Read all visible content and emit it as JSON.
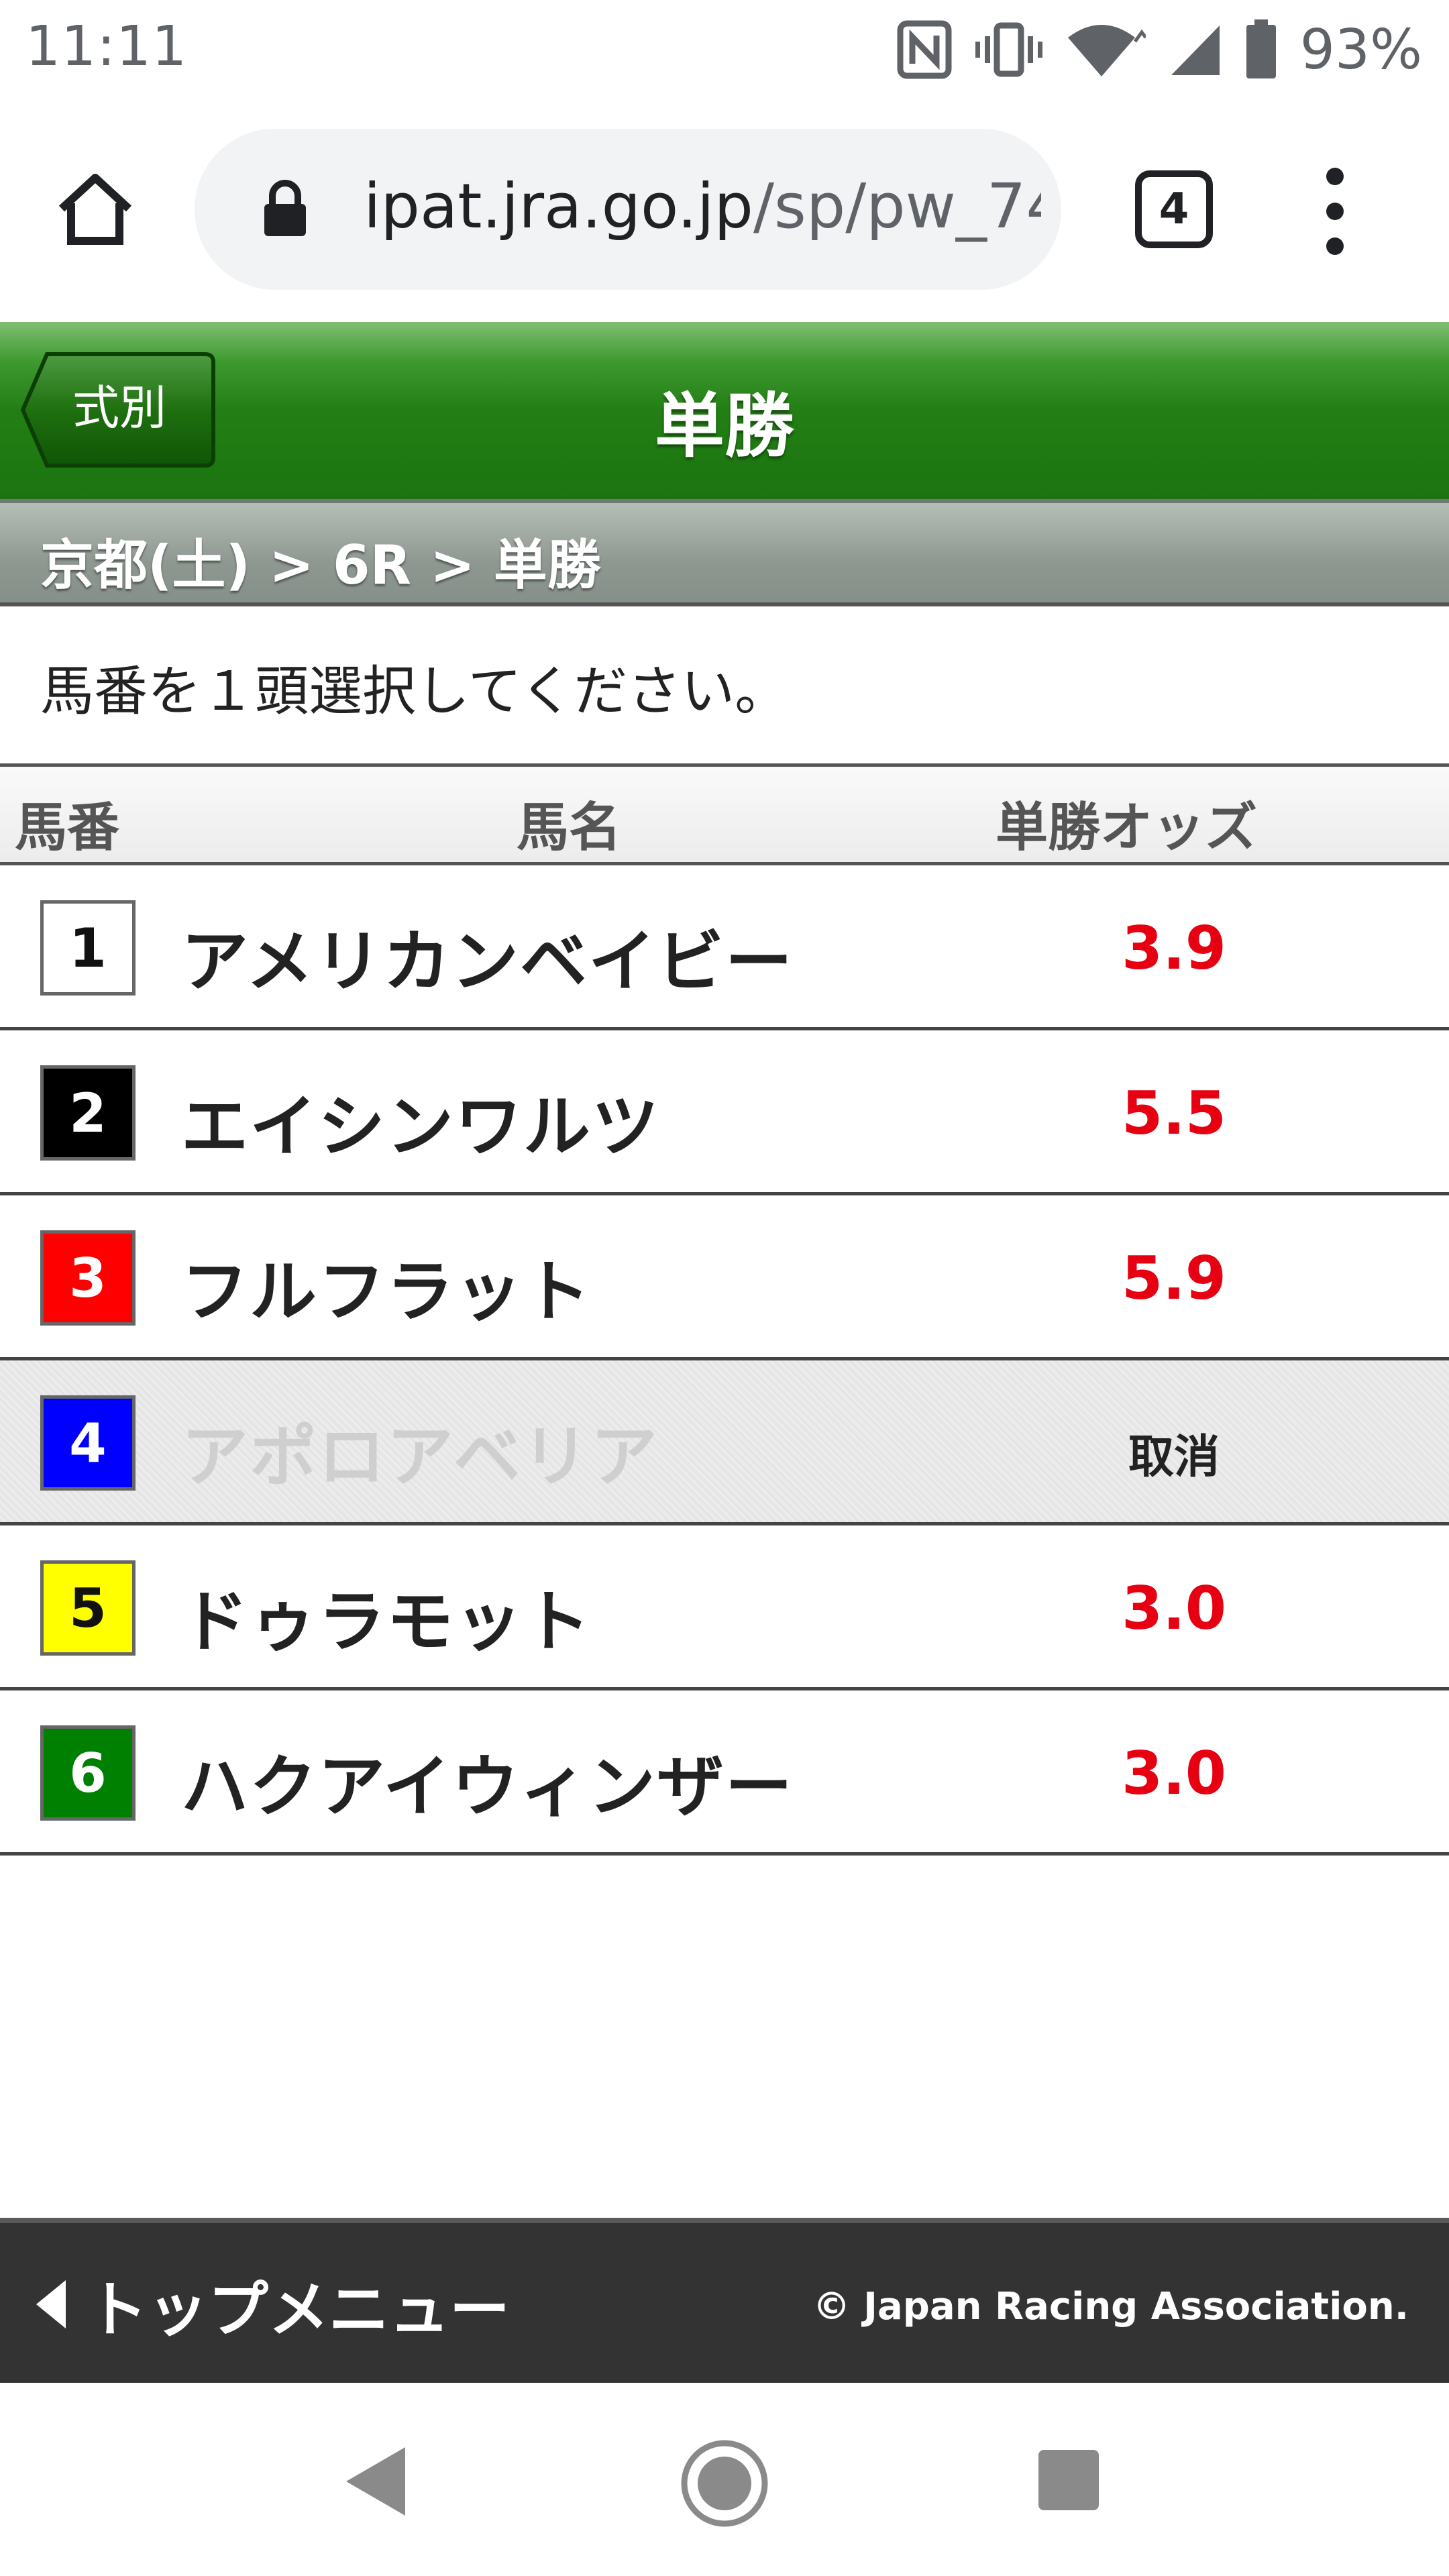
{
  "status_bar": {
    "time": "11:11",
    "battery": "93%"
  },
  "browser": {
    "url_host": "ipat.jra.go.jp",
    "url_path": "/sp/pw_74",
    "tab_count": "4"
  },
  "header": {
    "back_label": "式別",
    "title": "単勝"
  },
  "breadcrumb": "京都(土) > 6R > 単勝",
  "instruction": "馬番を１頭選択してください。",
  "table": {
    "headers": {
      "number": "馬番",
      "name": "馬名",
      "odds": "単勝オッズ"
    },
    "rows": [
      {
        "number": "1",
        "name": "アメリカンベイビー",
        "odds": "3.9",
        "badge_bg": "#ffffff",
        "badge_fg": "#111111",
        "scratched": false
      },
      {
        "number": "2",
        "name": "エイシンワルツ",
        "odds": "5.5",
        "badge_bg": "#000000",
        "badge_fg": "#ffffff",
        "scratched": false
      },
      {
        "number": "3",
        "name": "フルフラット",
        "odds": "5.9",
        "badge_bg": "#ff0000",
        "badge_fg": "#ffffff",
        "scratched": false
      },
      {
        "number": "4",
        "name": "アポロアベリア",
        "odds": "取消",
        "badge_bg": "#0000ff",
        "badge_fg": "#ffffff",
        "scratched": true
      },
      {
        "number": "5",
        "name": "ドゥラモット",
        "odds": "3.0",
        "badge_bg": "#ffff00",
        "badge_fg": "#111111",
        "scratched": false
      },
      {
        "number": "6",
        "name": "ハクアイウィンザー",
        "odds": "3.0",
        "badge_bg": "#008000",
        "badge_fg": "#ffffff",
        "scratched": false
      }
    ]
  },
  "footer": {
    "top_menu_label": "トップメニュー",
    "copyright": "© Japan Racing Association."
  },
  "colors": {
    "header_green": "#237f15",
    "odds_red": "#e60012",
    "footer_bg": "#333333"
  }
}
